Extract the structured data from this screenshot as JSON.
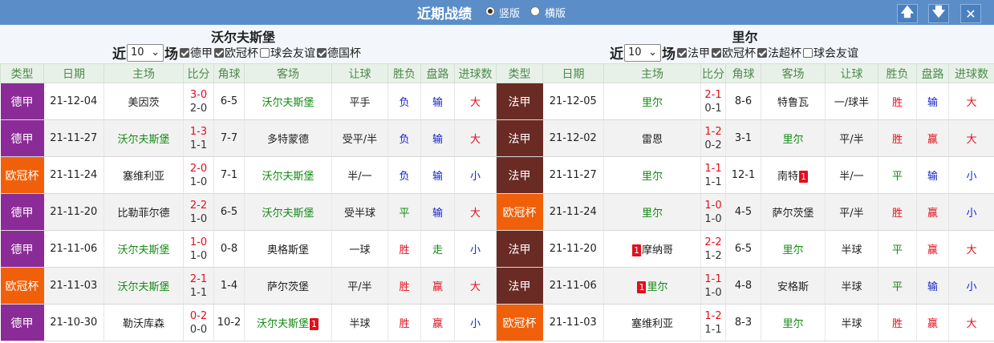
{
  "header": {
    "title": "近期战绩",
    "vertical_label": "竖版",
    "horizontal_label": "横版",
    "up_icon": "🡅",
    "down_icon": "🡇",
    "close_icon": "✕"
  },
  "columns": [
    "类型",
    "日期",
    "主场",
    "比分",
    "角球",
    "客场",
    "让球",
    "胜负",
    "盘路",
    "进球数"
  ],
  "left": {
    "team": "沃尔夫斯堡",
    "near": "近",
    "count": "10",
    "games": "场",
    "filters": [
      {
        "label": "德甲",
        "checked": true
      },
      {
        "label": "欧冠杯",
        "checked": true
      },
      {
        "label": "球会友谊",
        "checked": false
      },
      {
        "label": "德国杯",
        "checked": true
      }
    ],
    "rows": [
      {
        "league": "德甲",
        "date": "21-12-04",
        "home": "美因茨",
        "ft": "3-0",
        "ht": "2-0",
        "corner": "6-5",
        "away": "沃尔夫斯堡",
        "away_card": "",
        "home_card": "",
        "handicap": "平手",
        "result": "负",
        "pan": "输",
        "goals": "大"
      },
      {
        "league": "德甲",
        "date": "21-11-27",
        "home": "沃尔夫斯堡",
        "ft": "1-3",
        "ht": "1-1",
        "corner": "7-7",
        "away": "多特蒙德",
        "away_card": "",
        "home_card": "",
        "handicap": "受平/半",
        "result": "负",
        "pan": "输",
        "goals": "大"
      },
      {
        "league": "欧冠杯",
        "date": "21-11-24",
        "home": "塞维利亚",
        "ft": "2-0",
        "ht": "1-0",
        "corner": "7-1",
        "away": "沃尔夫斯堡",
        "away_card": "",
        "home_card": "",
        "handicap": "半/一",
        "result": "负",
        "pan": "输",
        "goals": "小"
      },
      {
        "league": "德甲",
        "date": "21-11-20",
        "home": "比勒菲尔德",
        "ft": "2-2",
        "ht": "1-0",
        "corner": "6-5",
        "away": "沃尔夫斯堡",
        "away_card": "",
        "home_card": "",
        "handicap": "受半球",
        "result": "平",
        "pan": "输",
        "goals": "大"
      },
      {
        "league": "德甲",
        "date": "21-11-06",
        "home": "沃尔夫斯堡",
        "ft": "1-0",
        "ht": "1-0",
        "corner": "0-8",
        "away": "奥格斯堡",
        "away_card": "",
        "home_card": "",
        "handicap": "一球",
        "result": "胜",
        "pan": "走",
        "goals": "小"
      },
      {
        "league": "欧冠杯",
        "date": "21-11-03",
        "home": "沃尔夫斯堡",
        "ft": "2-1",
        "ht": "1-1",
        "corner": "1-4",
        "away": "萨尔茨堡",
        "away_card": "",
        "home_card": "",
        "handicap": "平/半",
        "result": "胜",
        "pan": "赢",
        "goals": "大"
      },
      {
        "league": "德甲",
        "date": "21-10-30",
        "home": "勒沃库森",
        "ft": "0-2",
        "ht": "0-0",
        "corner": "10-2",
        "away": "沃尔夫斯堡",
        "away_card": "1",
        "home_card": "",
        "handicap": "半球",
        "result": "胜",
        "pan": "赢",
        "goals": "小"
      }
    ]
  },
  "right": {
    "team": "里尔",
    "near": "近",
    "count": "10",
    "games": "场",
    "filters": [
      {
        "label": "法甲",
        "checked": true
      },
      {
        "label": "欧冠杯",
        "checked": true
      },
      {
        "label": "法超杯",
        "checked": true
      },
      {
        "label": "球会友谊",
        "checked": false
      }
    ],
    "rows": [
      {
        "league": "法甲",
        "date": "21-12-05",
        "home": "里尔",
        "ft": "2-1",
        "ht": "0-1",
        "corner": "8-6",
        "away": "特鲁瓦",
        "away_card": "",
        "home_card": "",
        "handicap": "一/球半",
        "result": "胜",
        "pan": "输",
        "goals": "大"
      },
      {
        "league": "法甲",
        "date": "21-12-02",
        "home": "雷恩",
        "ft": "1-2",
        "ht": "0-2",
        "corner": "3-1",
        "away": "里尔",
        "away_card": "",
        "home_card": "",
        "handicap": "平/半",
        "result": "胜",
        "pan": "赢",
        "goals": "大"
      },
      {
        "league": "法甲",
        "date": "21-11-27",
        "home": "里尔",
        "ft": "1-1",
        "ht": "1-1",
        "corner": "12-1",
        "away": "南特",
        "away_card": "1",
        "home_card": "",
        "handicap": "半/一",
        "result": "平",
        "pan": "输",
        "goals": "小"
      },
      {
        "league": "欧冠杯",
        "date": "21-11-24",
        "home": "里尔",
        "ft": "1-0",
        "ht": "1-0",
        "corner": "4-5",
        "away": "萨尔茨堡",
        "away_card": "",
        "home_card": "",
        "handicap": "平/半",
        "result": "胜",
        "pan": "赢",
        "goals": "小"
      },
      {
        "league": "法甲",
        "date": "21-11-20",
        "home": "摩纳哥",
        "ft": "2-2",
        "ht": "1-2",
        "corner": "6-5",
        "away": "里尔",
        "away_card": "",
        "home_card": "1",
        "handicap": "半球",
        "result": "平",
        "pan": "赢",
        "goals": "大"
      },
      {
        "league": "法甲",
        "date": "21-11-06",
        "home": "里尔",
        "ft": "1-1",
        "ht": "1-0",
        "corner": "4-8",
        "away": "安格斯",
        "away_card": "",
        "home_card": "1",
        "handicap": "半球",
        "result": "平",
        "pan": "输",
        "goals": "小"
      },
      {
        "league": "欧冠杯",
        "date": "21-11-03",
        "home": "塞维利亚",
        "ft": "1-2",
        "ht": "1-1",
        "corner": "8-3",
        "away": "里尔",
        "away_card": "",
        "home_card": "",
        "handicap": "半球",
        "result": "胜",
        "pan": "赢",
        "goals": "大"
      }
    ]
  },
  "colors": {
    "header_bar": "#5b8ec9",
    "bundesliga": "#8b2b97",
    "champions_league": "#f0600a",
    "ligue1": "#6a2b25",
    "team_green": "#138a13",
    "red": "#e0101e",
    "blue": "#1424c8"
  }
}
